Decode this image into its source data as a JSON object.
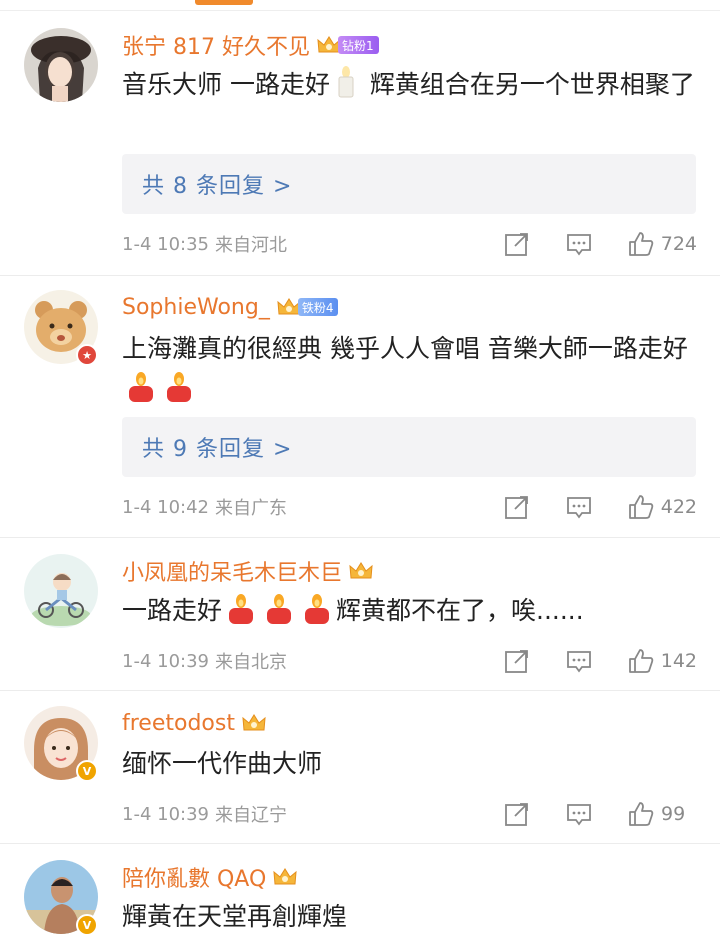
{
  "comments": [
    {
      "username": "张宁 817 好久不见",
      "fan_badge": "钻粉1",
      "content_before": "音乐大师 一路走好",
      "content_after": " 辉黄组合在另一个世界相聚了",
      "reply_label": "共 8 条回复 >",
      "time": "1-4 10:35",
      "from": "来自河北",
      "likes": "724"
    },
    {
      "username": "SophieWong_",
      "fan_badge": "铁粉4",
      "content_before": "上海灘真的很經典 幾乎人人會唱 音樂大師一路走好",
      "reply_label": "共 9 条回复 >",
      "time": "1-4 10:42",
      "from": "来自广东",
      "likes": "422"
    },
    {
      "username": "小凤凰的呆毛木巨木巨",
      "content_before": "一路走好",
      "content_after": "辉黄都不在了，唉......",
      "time": "1-4 10:39",
      "from": "来自北京",
      "likes": "142"
    },
    {
      "username": "freetodost",
      "content_before": "缅怀一代作曲大师",
      "time": "1-4 10:39",
      "from": "来自辽宁",
      "likes": "99"
    },
    {
      "username": "陪你亂數 QAQ",
      "content_before": "輝黃在天堂再創輝煌"
    }
  ],
  "icons": {
    "share": "share-icon",
    "comment": "comment-icon",
    "like": "thumbs-up-icon",
    "crown": "crown-badge-icon",
    "candle": "candle-emoji"
  },
  "colors": {
    "username": "#e8772e",
    "reply_link": "#4d79b5",
    "meta": "#9a9a9a",
    "reply_bg": "#f3f3f5"
  }
}
